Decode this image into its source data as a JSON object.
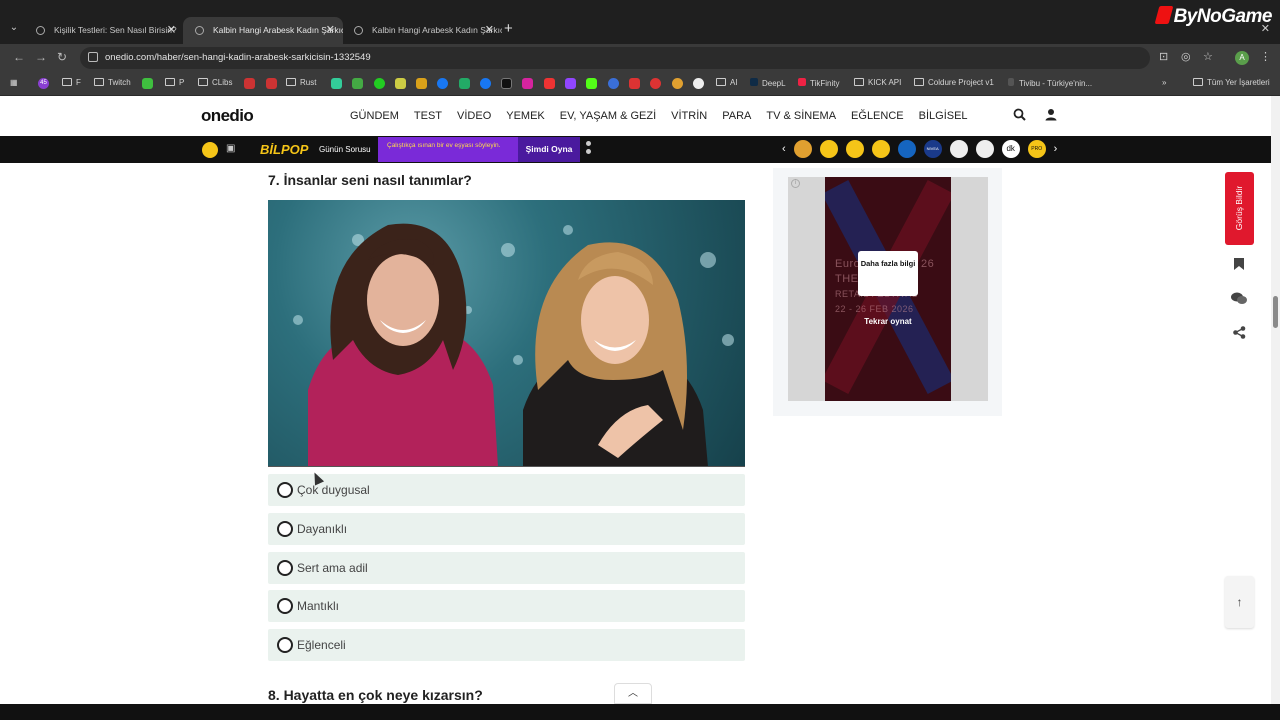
{
  "browser": {
    "tabs": [
      {
        "title": "Kişilik Testleri: Sen Nasıl Birisin?",
        "active": false
      },
      {
        "title": "Kalbin Hangi Arabesk Kadın Şarkıcısı",
        "active": true
      },
      {
        "title": "Kalbin Hangi Arabesk Kadın Şarkıcısı",
        "active": false
      }
    ],
    "url": "onedio.com/haber/sen-hangi-kadin-arabesk-sarkicisin-1332549",
    "profile_initial": "A",
    "overlay_logo": "ByNoGame",
    "bookmarks": [
      "F",
      "Twitch",
      "P",
      "CLibs",
      "Rust",
      "AI",
      "DeepL",
      "TikFinity",
      "KICK API",
      "Coldure Project v1",
      "Tivibu - Türkiye'nin...",
      "Tüm Yer İşaretleri"
    ],
    "bookmark_badge": "45"
  },
  "site": {
    "logo": "onedio",
    "nav": [
      "GÜNDEM",
      "TEST",
      "VİDEO",
      "YEMEK",
      "EV, YAŞAM & GEZİ",
      "VİTRİN",
      "PARA",
      "TV & SİNEMA",
      "EĞLENCE",
      "BİLGİSEL"
    ]
  },
  "bilpop": {
    "logo": "BİLPOP",
    "question_label": "Günün Sorusu",
    "promo": "Çalıştıkça ısınan bir ev eşyası söyleyin.",
    "play_label": "Şimdi Oyna",
    "emoji_badges": [
      "NIVEA",
      "dk",
      "PRO"
    ]
  },
  "quiz": {
    "question": "7. İnsanlar seni nasıl tanımlar?",
    "options": [
      "Çok duygusal",
      "Dayanıklı",
      "Sert ama adil",
      "Mantıklı",
      "Eğlenceli"
    ],
    "next_question": "8. Hayatta en çok neye kızarsın?"
  },
  "ad": {
    "more_info": "Daha fazla bilgi",
    "replay": "Tekrar oynat",
    "bg_lines": [
      "Euro",
      "26",
      "THE",
      "RETAIL FESTIVAL",
      "22 - 26 FEB 2026"
    ]
  },
  "sidebar": {
    "report_label": "Görüş Bildir"
  },
  "colors": {
    "accent_red": "#e0182d",
    "bilpop_yellow": "#f5c518",
    "promo_purple": "#7a2ad8",
    "option_bg": "#eaf2ee"
  }
}
